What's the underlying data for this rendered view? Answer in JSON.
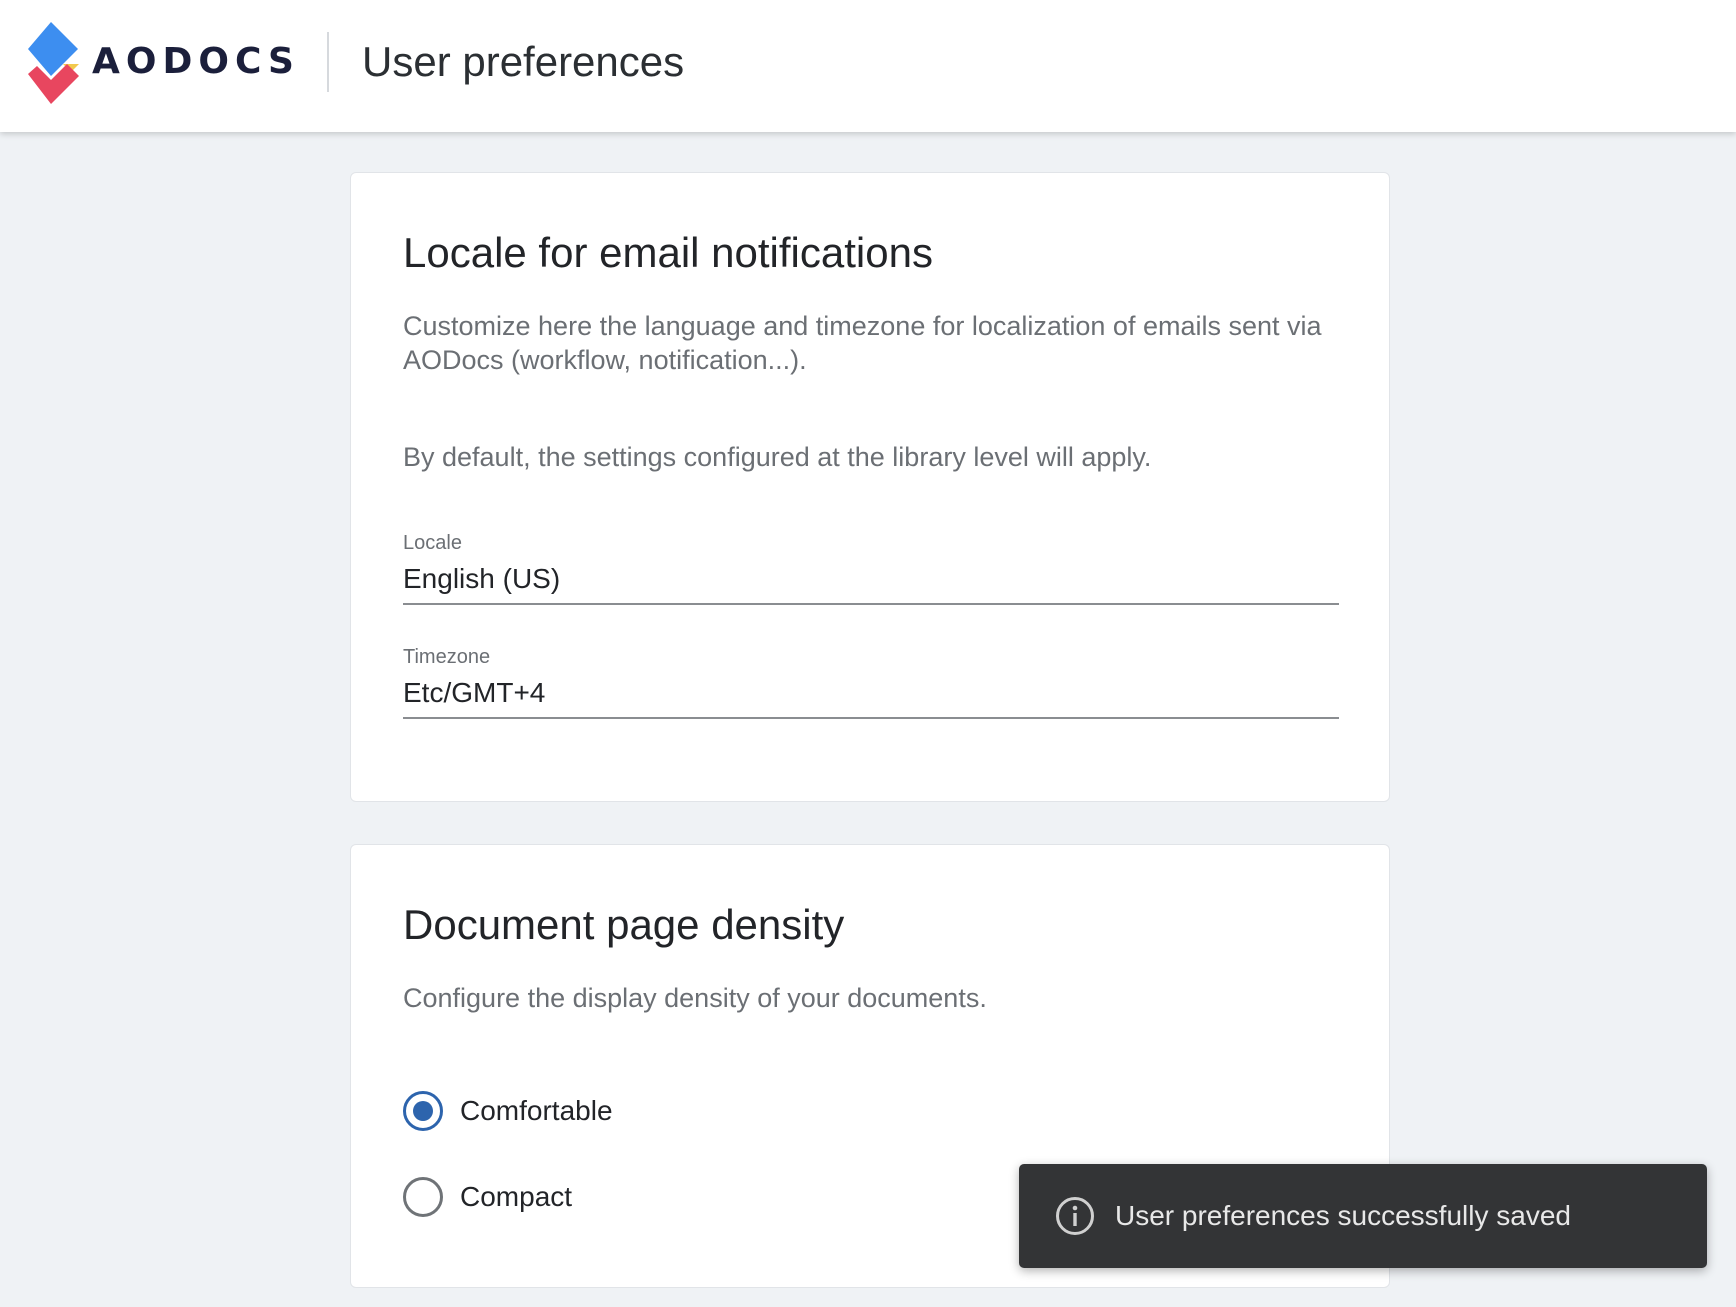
{
  "header": {
    "logo_text": "AODOCS",
    "title": "User preferences"
  },
  "locale_card": {
    "title": "Locale for email notifications",
    "description": "Customize here the language and timezone for localization of emails sent via AODocs (workflow, notification...).",
    "default_note": "By default, the settings configured at the library level will apply.",
    "locale": {
      "label": "Locale",
      "value": "English (US)"
    },
    "timezone": {
      "label": "Timezone",
      "value": "Etc/GMT+4"
    }
  },
  "density_card": {
    "title": "Document page density",
    "description": "Configure the display density of your documents.",
    "options": [
      {
        "label": "Comfortable",
        "selected": true
      },
      {
        "label": "Compact",
        "selected": false
      }
    ]
  },
  "toast": {
    "icon": "info-icon",
    "message": "User preferences successfully saved"
  },
  "colors": {
    "accent": "#2d64ad",
    "page_background": "#eff2f5",
    "toast_background": "#333436",
    "logo_blue": "#3d8ef0",
    "logo_red": "#e8465f",
    "logo_yellow": "#f2c94c"
  }
}
